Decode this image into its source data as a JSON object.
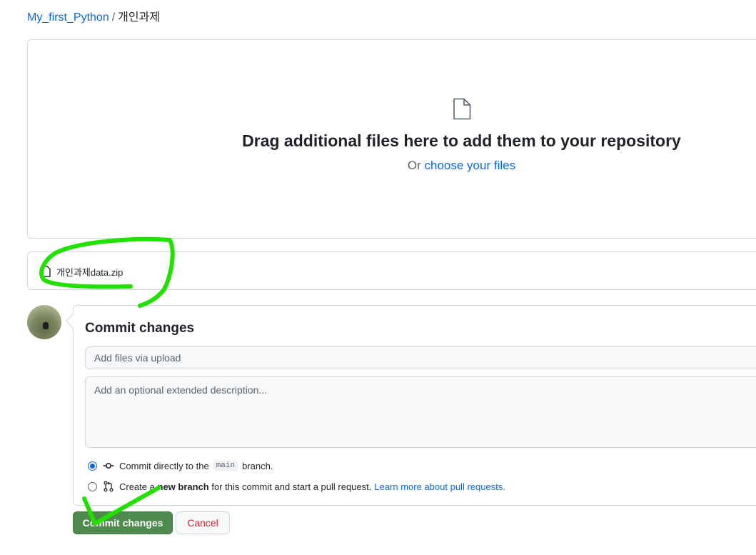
{
  "breadcrumb": {
    "repo": "My_first_Python",
    "separator": "/",
    "current": "개인과제"
  },
  "dropzone": {
    "icon": "file-icon",
    "title": "Drag additional files here to add them to your repository",
    "or_text": "Or",
    "choose_link": "choose your files"
  },
  "files": [
    {
      "icon": "file-icon",
      "name": "개인과제data.zip"
    }
  ],
  "commit": {
    "heading": "Commit changes",
    "summary_placeholder": "Add files via upload",
    "description_placeholder": "Add an optional extended description...",
    "option_direct": {
      "selected": true,
      "icon": "git-commit-icon",
      "before": "Commit directly to the",
      "branch": "main",
      "after": "branch."
    },
    "option_new_branch": {
      "selected": false,
      "icon": "git-pull-request-icon",
      "before": "Create a",
      "bold": "new branch",
      "after": "for this commit and start a pull request.",
      "link": "Learn more about pull requests."
    },
    "commit_button": "Commit changes",
    "cancel_button": "Cancel"
  },
  "colors": {
    "link": "#0969da",
    "commit_button": "#4e8a4e",
    "cancel_text": "#d1242f",
    "annotation_marker": "#22e000"
  }
}
